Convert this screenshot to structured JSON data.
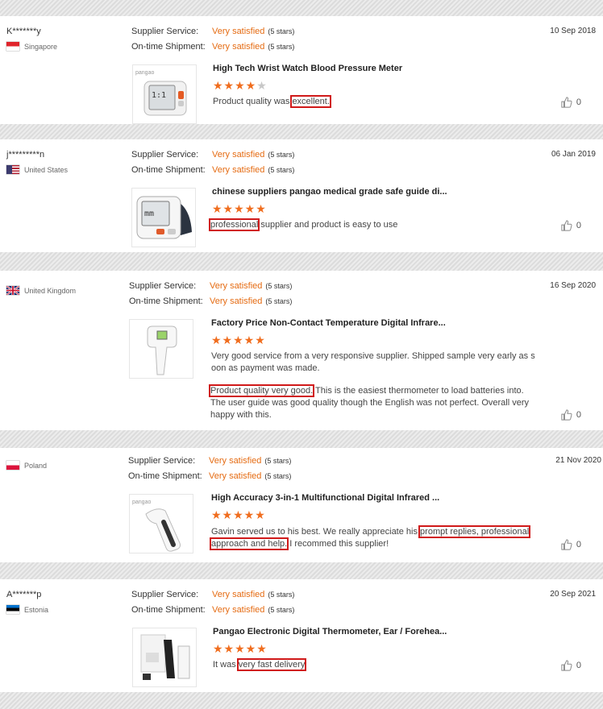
{
  "labels": {
    "supplier_service": "Supplier Service:",
    "ontime_shipment": "On-time Shipment:",
    "rating_text": "Very satisfied",
    "stars_text": "(5 stars)"
  },
  "colors": {
    "accent": "#e56b12",
    "highlight": "#d01919",
    "star_off": "#c8c8c8"
  },
  "reviews": [
    {
      "user": "K*******y",
      "country": "Singapore",
      "date": "10 Sep 2018",
      "product_title": "High Tech Wrist Watch Blood Pressure Meter",
      "rating": 4,
      "comment": [
        "Product quality was ",
        "excellent."
      ],
      "likes": "0",
      "thumb_logo": "pangao"
    },
    {
      "user": "j*********n",
      "country": "United States",
      "date": "06 Jan 2019",
      "product_title": "chinese suppliers pangao medical grade safe guide di...",
      "rating": 5,
      "comment": [
        "professional",
        " supplier and product is easy to use"
      ],
      "likes": "0"
    },
    {
      "user": "",
      "country": "United Kingdom",
      "date": "16 Sep 2020",
      "product_title": "Factory Price Non-Contact Temperature Digital Infrare...",
      "rating": 5,
      "comment_lines": [
        "Very good service from a very responsive supplier. Shipped sample very early as s",
        "oon as payment was made."
      ],
      "comment2": [
        "Product quality very good.",
        " This is the easiest thermometer to load batteries into.",
        "The user guide was good quality though the English was not perfect. Overall very",
        "happy with this."
      ],
      "likes": "0"
    },
    {
      "user": "",
      "country": "Poland",
      "date": "21 Nov 2020",
      "product_title": "High Accuracy 3-in-1 Multifunctional Digital Infrared ...",
      "rating": 5,
      "comment": [
        "Gavin served us to his best. We really appreciate his ",
        "prompt replies, professional",
        "approach and help.",
        " I recommed this supplier!"
      ],
      "likes": "0",
      "thumb_logo": "pangao"
    },
    {
      "user": "A*******p",
      "country": "Estonia",
      "date": "20 Sep 2021",
      "product_title": "Pangao Electronic Digital Thermometer, Ear / Forehea...",
      "rating": 5,
      "comment": [
        "It was ",
        "very fast delivery"
      ],
      "likes": "0"
    }
  ]
}
